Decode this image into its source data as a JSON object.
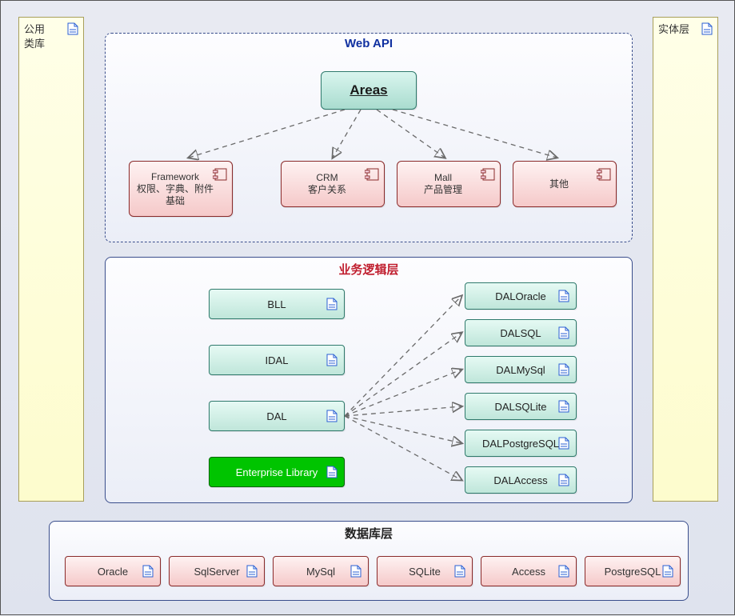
{
  "packages": {
    "common": {
      "title": "公用\n类库"
    },
    "entity": {
      "title": "实体层"
    }
  },
  "webapi": {
    "title": "Web API",
    "areas": "Areas",
    "components": [
      {
        "name": "Framework",
        "desc": "权限、字典、附件基础"
      },
      {
        "name": "CRM",
        "desc": "客户关系"
      },
      {
        "name": "Mall",
        "desc": "产品管理"
      },
      {
        "name": "其他",
        "desc": ""
      }
    ]
  },
  "logic": {
    "title": "业务逻辑层",
    "left": [
      "BLL",
      "IDAL",
      "DAL",
      "Enterprise Library"
    ],
    "right": [
      "DALOracle",
      "DALSQL",
      "DALMySql",
      "DALSQLite",
      "DALPostgreSQL",
      "DALAccess"
    ]
  },
  "dblayer": {
    "title": "数据库层",
    "dbs": [
      "Oracle",
      "SqlServer",
      "MySql",
      "SQLite",
      "Access",
      "PostgreSQL"
    ]
  }
}
